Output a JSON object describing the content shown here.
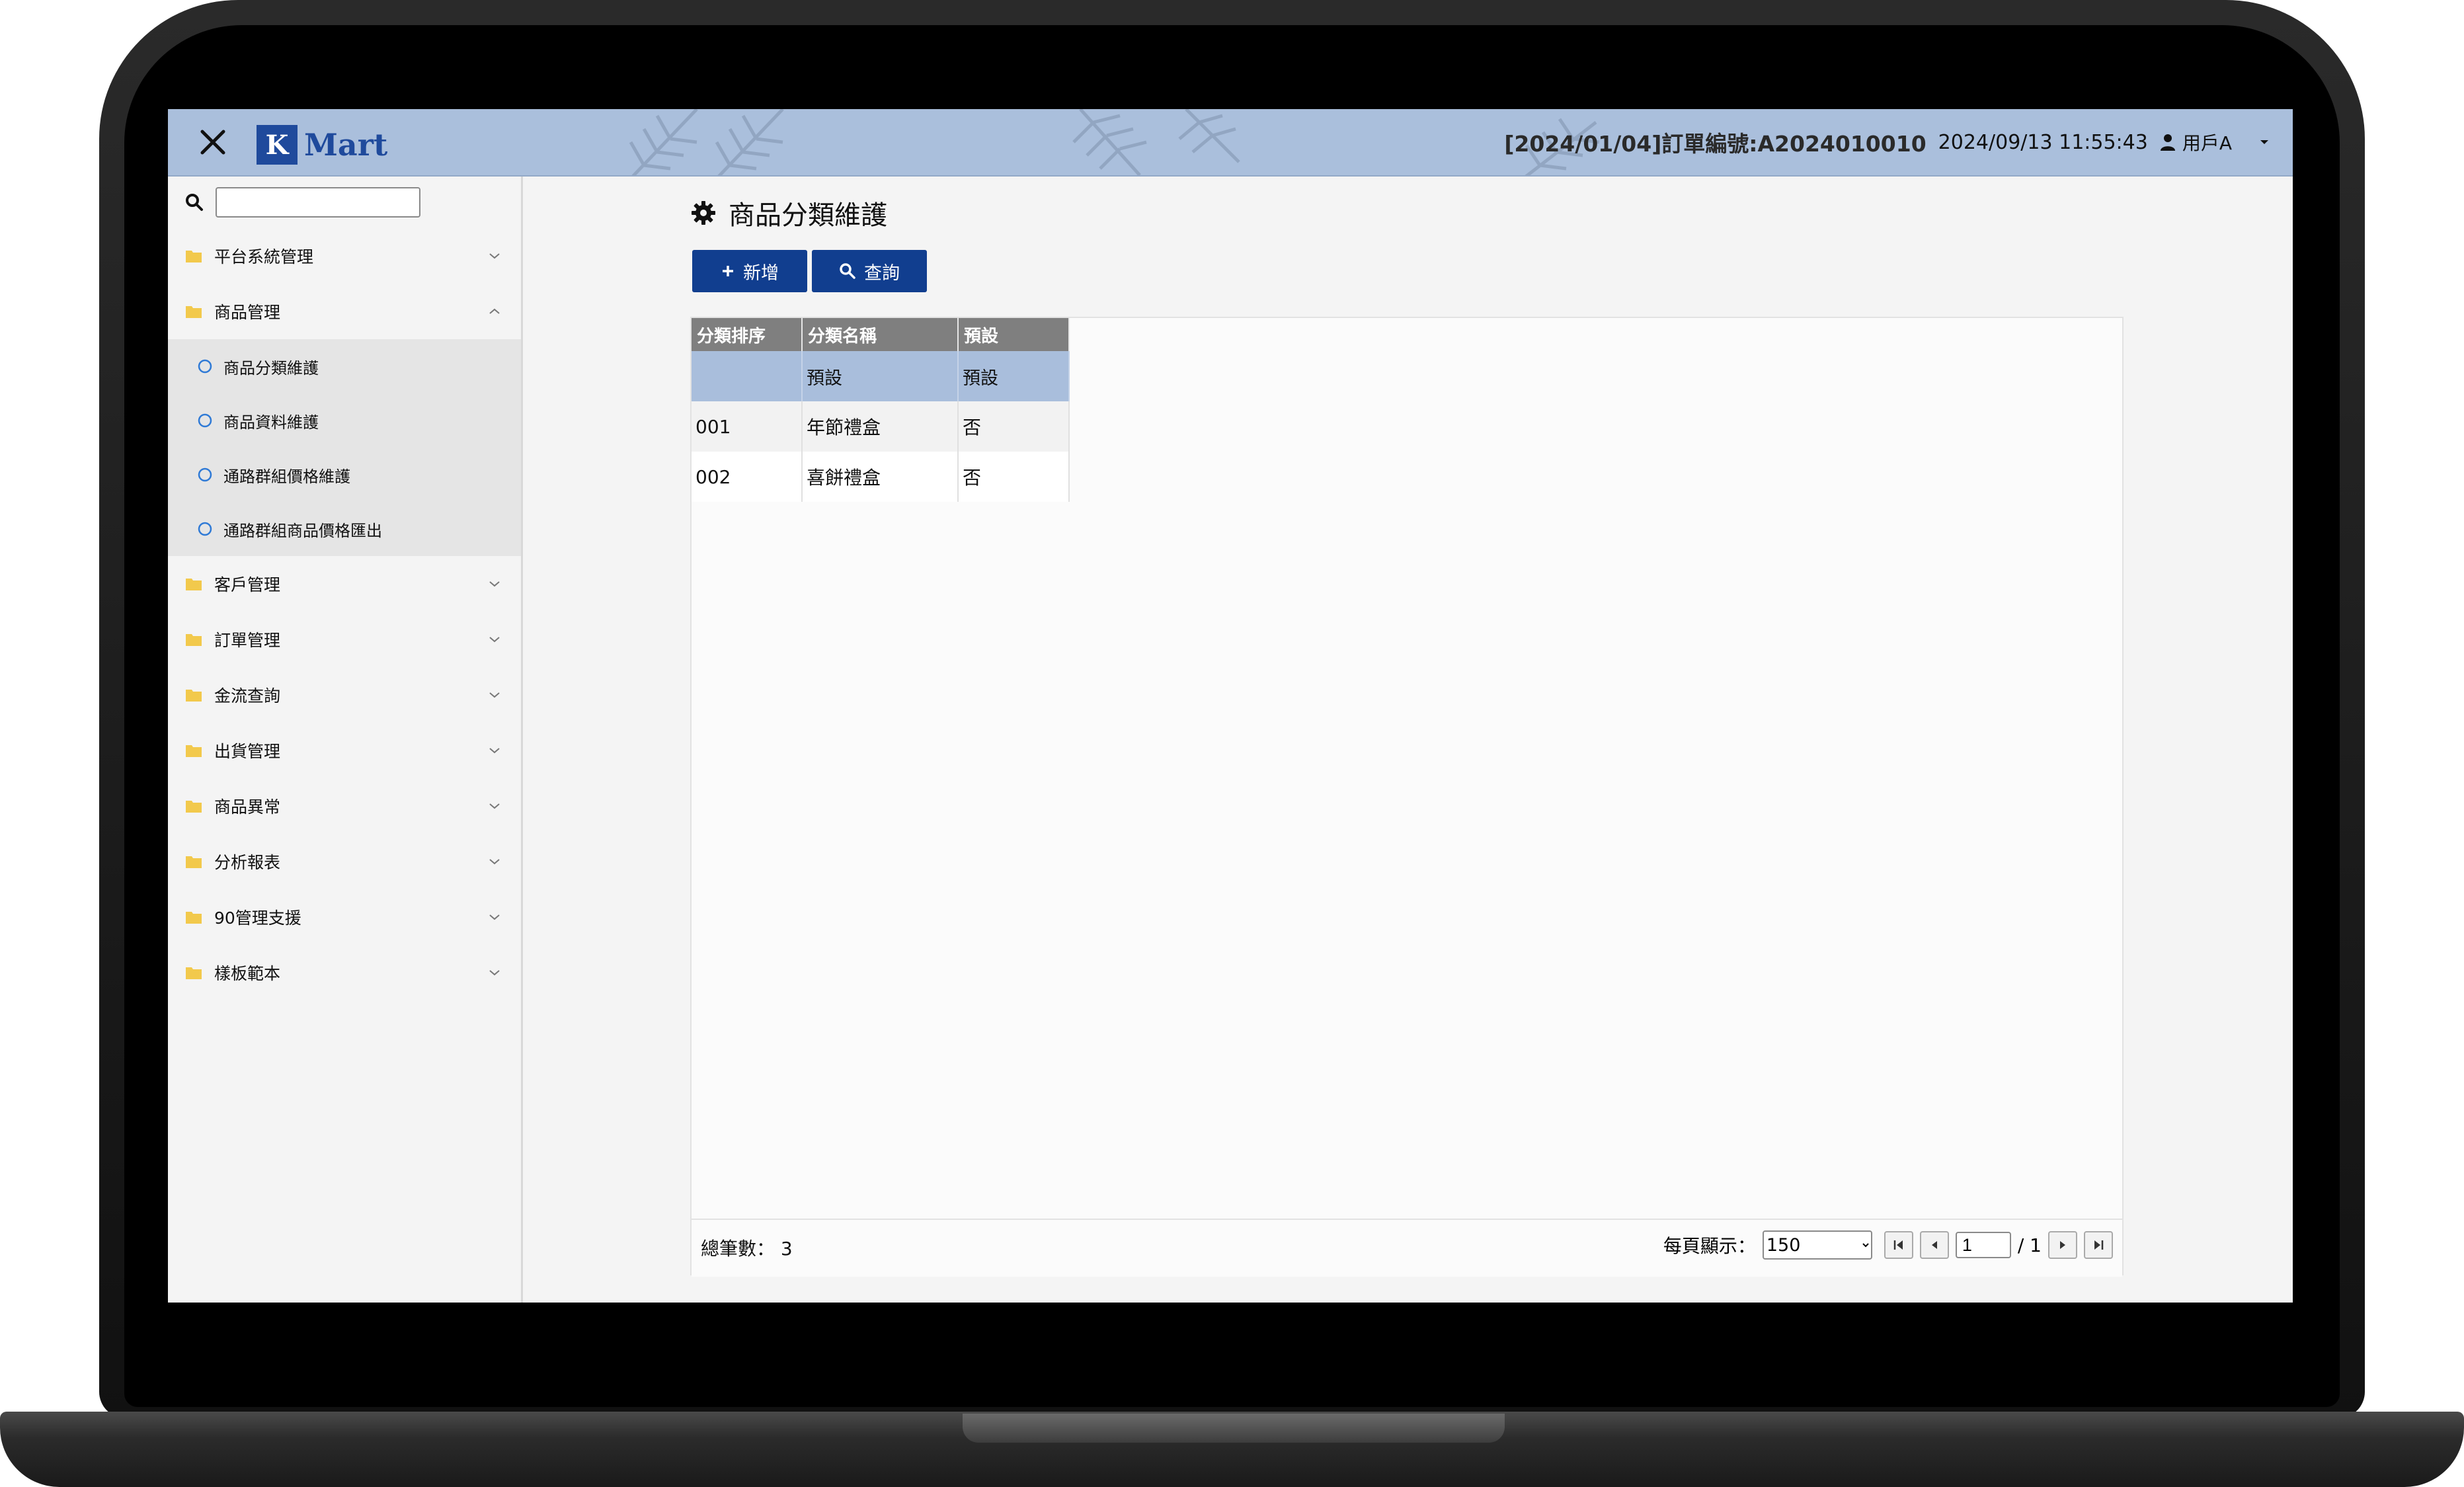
{
  "header": {
    "logo_box": "K",
    "logo_text": "Mart",
    "notice": "[2024/01/04]訂單編號:A2024010010",
    "datetime": "2024/09/13 11:55:43",
    "user": "用戶A"
  },
  "sidebar": {
    "search_value": "",
    "items": [
      {
        "label": "平台系統管理",
        "expanded": false
      },
      {
        "label": "商品管理",
        "expanded": true
      },
      {
        "label": "客戶管理",
        "expanded": false
      },
      {
        "label": "訂單管理",
        "expanded": false
      },
      {
        "label": "金流查詢",
        "expanded": false
      },
      {
        "label": "出貨管理",
        "expanded": false
      },
      {
        "label": "商品異常",
        "expanded": false
      },
      {
        "label": "分析報表",
        "expanded": false
      },
      {
        "label": "90管理支援",
        "expanded": false
      },
      {
        "label": "樣板範本",
        "expanded": false
      }
    ],
    "subitems": [
      {
        "label": "商品分類維護"
      },
      {
        "label": "商品資料維護"
      },
      {
        "label": "通路群組價格維護"
      },
      {
        "label": "通路群組商品價格匯出"
      }
    ]
  },
  "main": {
    "title": "商品分類維護",
    "add_label": "新增",
    "query_label": "查詢"
  },
  "grid": {
    "columns": [
      "分類排序",
      "分類名稱",
      "預設"
    ],
    "filter": [
      "",
      "預設",
      "預設"
    ],
    "rows": [
      [
        "001",
        "年節禮盒",
        "否"
      ],
      [
        "002",
        "喜餅禮盒",
        "否"
      ]
    ]
  },
  "footer": {
    "total_label": "總筆數：",
    "total_value": "3",
    "per_page_label": "每頁顯示：",
    "per_page_value": "150",
    "page_value": "1",
    "page_total": "/ 1"
  },
  "colors": {
    "header_bg": "#aabfdc",
    "button_bg": "#113e8f",
    "folder_icon": "#f2c94c",
    "sub_circle": "#2f7ad6"
  }
}
